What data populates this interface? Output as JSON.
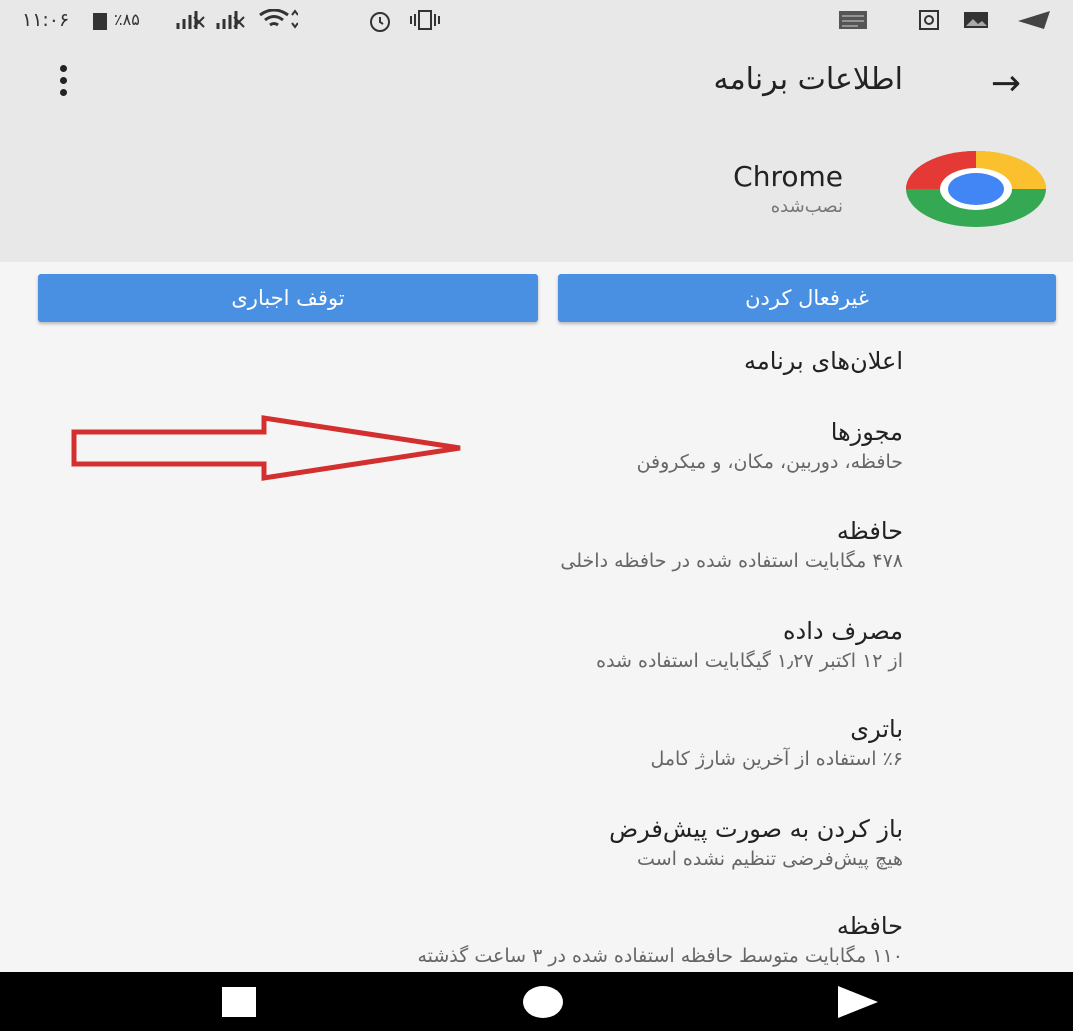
{
  "status_bar": {
    "time": "۱۱:۰۶",
    "battery": "٪۸۵",
    "icons": [
      "sim-card-icon",
      "battery-icon",
      "no-signal-icon",
      "no-signal-icon",
      "wifi-icon",
      "alarm-icon",
      "vibrate-icon",
      "notification-icon",
      "image-icon",
      "telegram-icon"
    ]
  },
  "header": {
    "title": "اطلاعات برنامه",
    "back_icon": "arrow-icon",
    "menu_icon": "more-vert-icon"
  },
  "app": {
    "name": "Chrome",
    "status": "نصب‌شده",
    "icon": "chrome-logo-icon"
  },
  "buttons": {
    "disable": "غیرفعال کردن",
    "force_stop": "توقف اجباری"
  },
  "items": [
    {
      "title": "اعلان‌های برنامه",
      "subtitle": ""
    },
    {
      "title": "مجوزها",
      "subtitle": "حافظه، دوربین، مکان، و میکروفن"
    },
    {
      "title": "حافظه",
      "subtitle": "۴۷۸ مگابایت استفاده شده در حافظه داخلی"
    },
    {
      "title": "مصرف داده",
      "subtitle": "از ۱۲ اکتبر ۱٫۲۷ گیگابایت استفاده شده"
    },
    {
      "title": "باتری",
      "subtitle": "٪۶ استفاده از آخرین شارژ کامل"
    },
    {
      "title": "باز کردن به صورت پیش‌فرض",
      "subtitle": "هیچ پیش‌فرضی تنظیم نشده است"
    },
    {
      "title": "حافظه",
      "subtitle": "۱۱۰ مگابایت متوسط حافظه استفاده شده در ۳ ساعت گذشته"
    }
  ],
  "annotation": {
    "icon": "red-arrow-icon",
    "color": "#d32f2f"
  },
  "nav": {
    "recents": "recents-icon",
    "home": "home-icon",
    "back": "back-triangle-icon"
  },
  "colors": {
    "accent": "#4a90e2",
    "header_bg": "#e8e8e8",
    "body_bg": "#f5f5f5"
  }
}
